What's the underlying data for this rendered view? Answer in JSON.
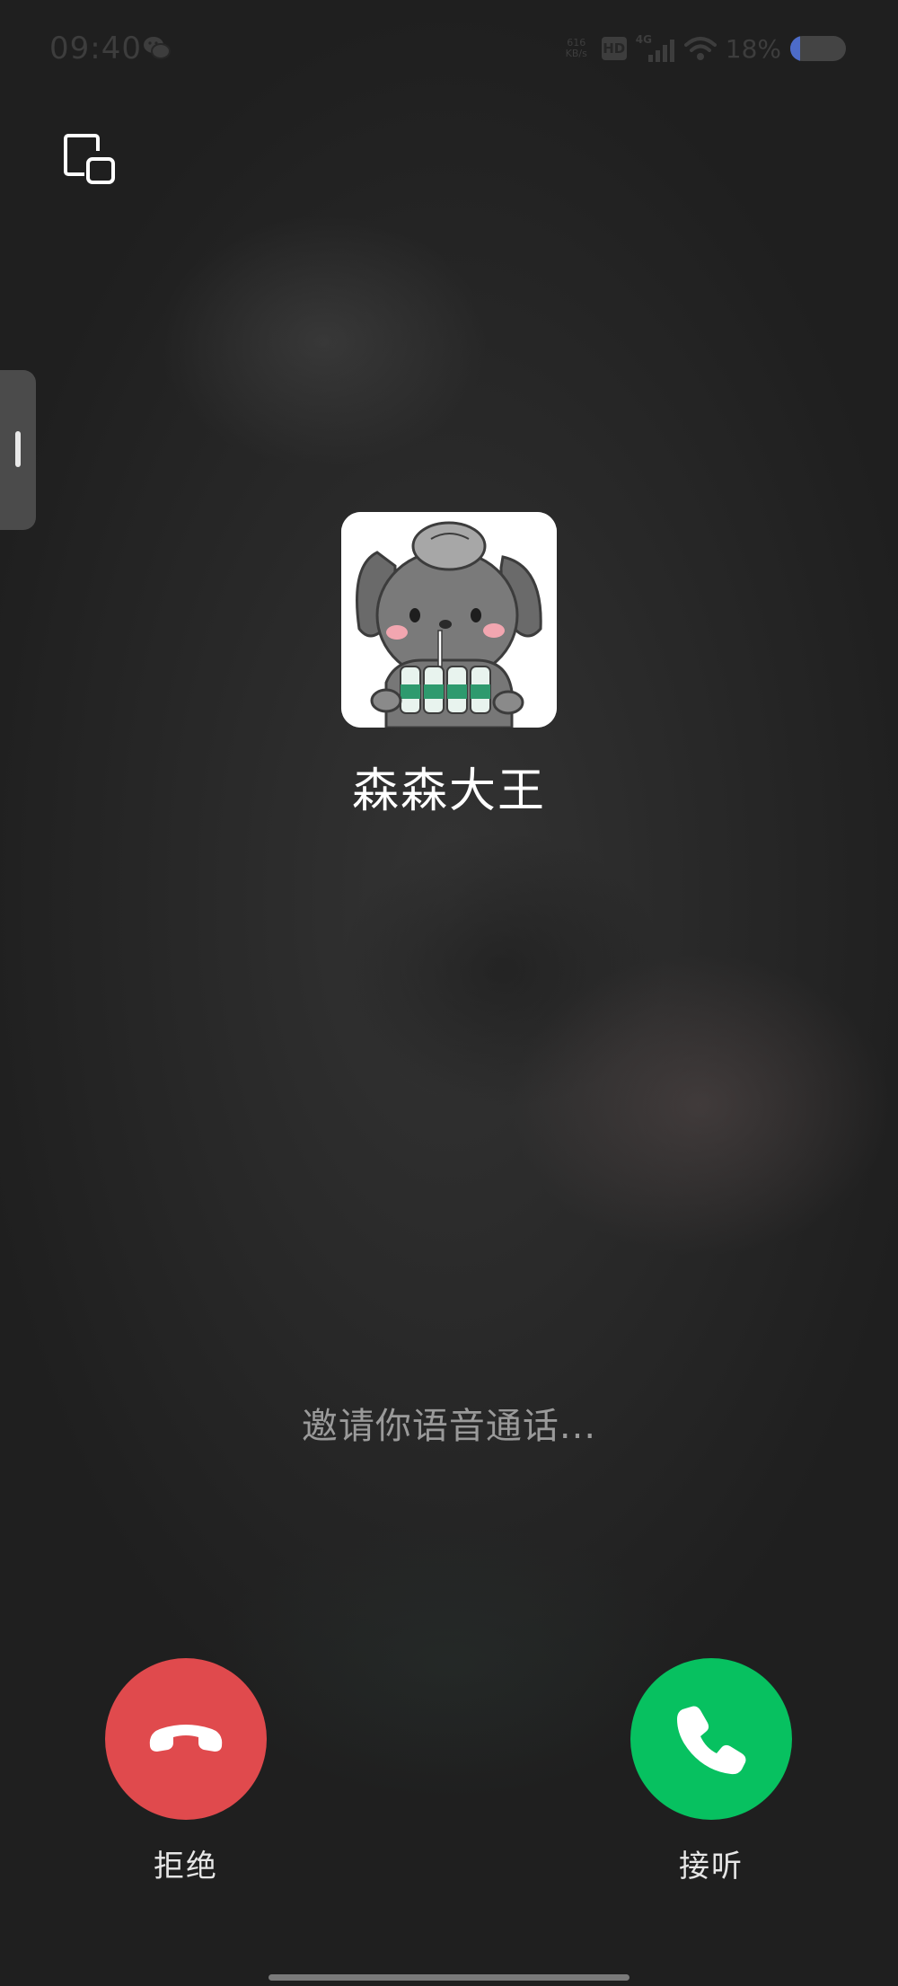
{
  "status_bar": {
    "time": "09:40",
    "net_speed_value": "616",
    "net_speed_unit": "KB/s",
    "hd_badge": "HD",
    "network_type": "4G",
    "battery_percent": "18%",
    "battery_level": 0.18,
    "icons": [
      "wechat-icon",
      "hd-icon",
      "signal-icon",
      "wifi-icon",
      "battery-icon"
    ]
  },
  "call": {
    "caller_name": "森森大王",
    "status_text": "邀请你语音通话..."
  },
  "actions": {
    "decline_label": "拒绝",
    "answer_label": "接听",
    "decline_color": "#e04a4d",
    "answer_color": "#07c160"
  }
}
